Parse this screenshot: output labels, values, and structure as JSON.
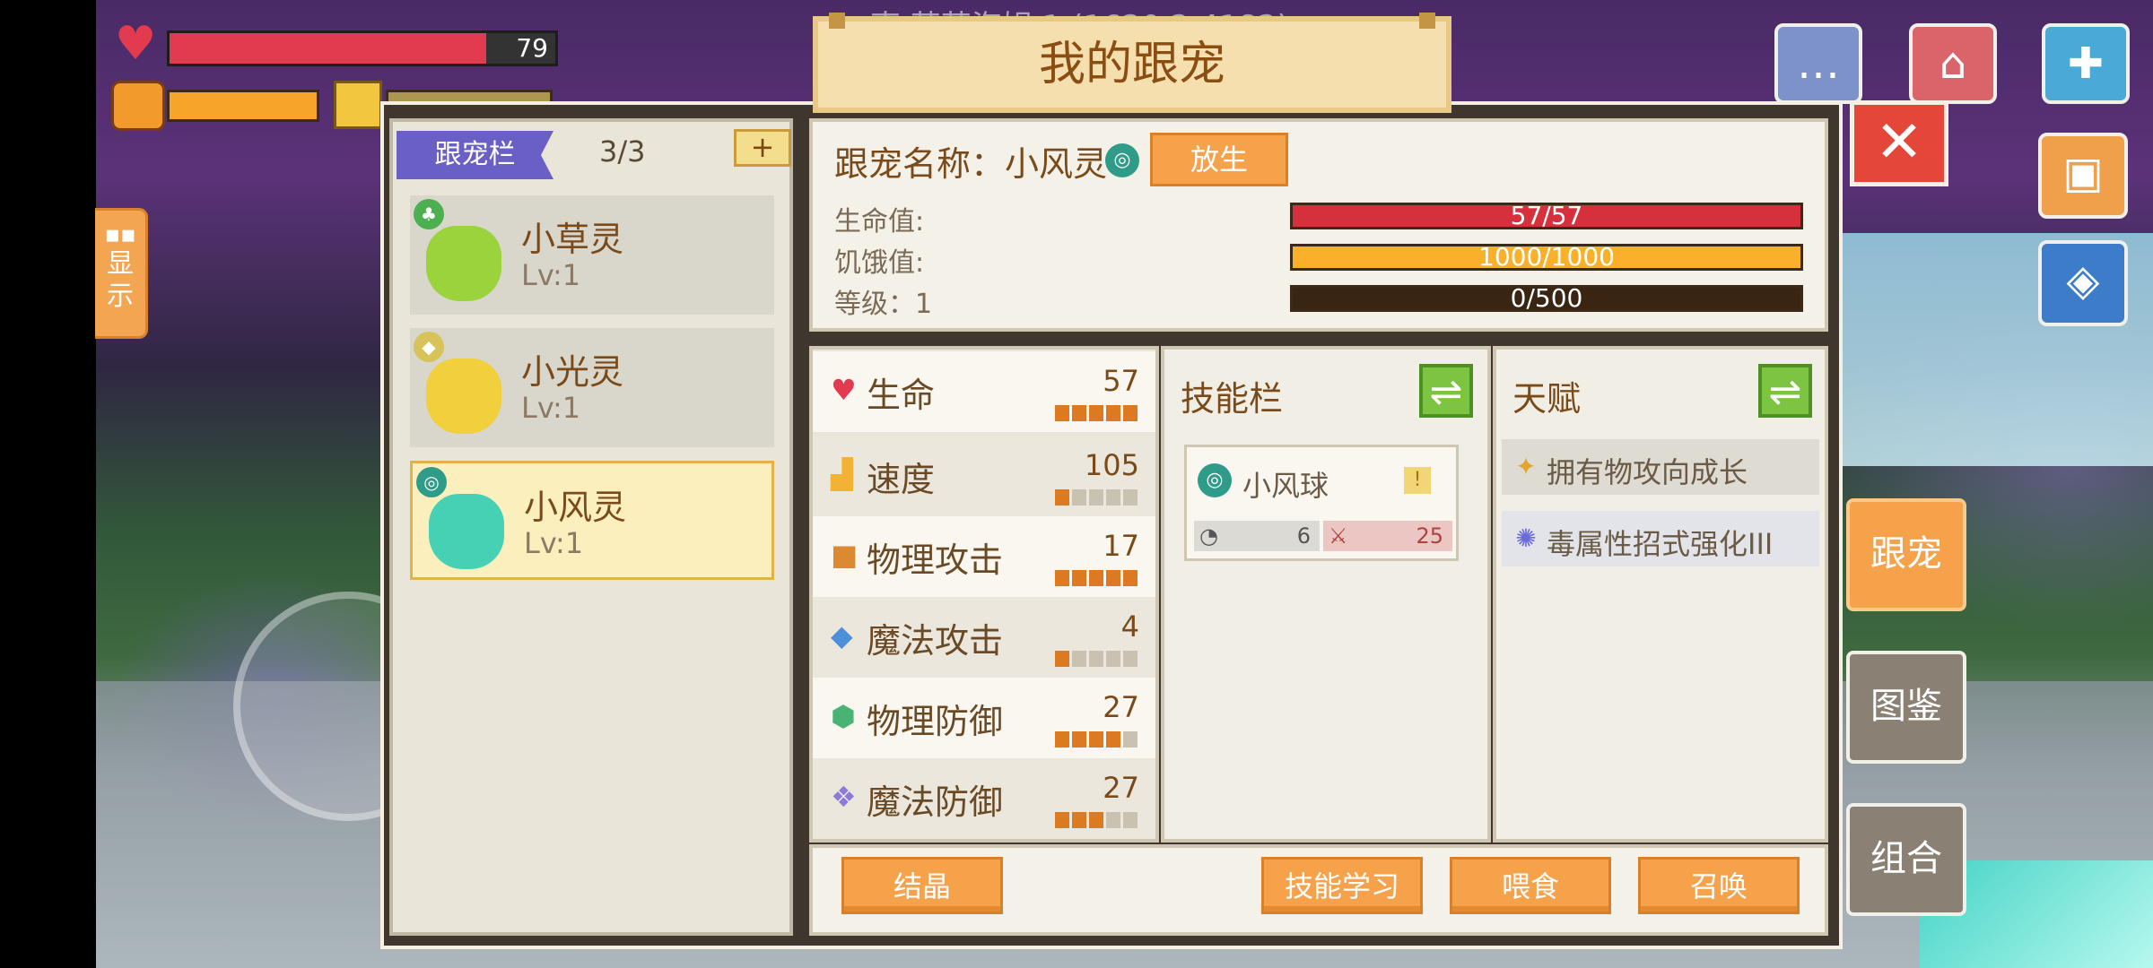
{
  "hud": {
    "hp_value": "79",
    "hp_fraction": 0.82,
    "top_text": "枣 营营海姆 1 (1620 2 4182)"
  },
  "show_tab": {
    "label_line1": "显",
    "label_line2": "示"
  },
  "title": "我的跟宠",
  "pet_list": {
    "header": "跟宠栏",
    "count": "3/3",
    "add_label": "+",
    "pets": [
      {
        "name": "小草灵",
        "level": "Lv:1",
        "color": "#9ad33b",
        "element_color": "#4caf50"
      },
      {
        "name": "小光灵",
        "level": "Lv:1",
        "color": "#f2cf3c",
        "element_color": "#d8c25a"
      },
      {
        "name": "小风灵",
        "level": "Lv:1",
        "color": "#47d1b4",
        "element_color": "#2f9b89"
      }
    ]
  },
  "info": {
    "name_label": "跟宠名称：小风灵",
    "release_label": "放生",
    "hp_label": "生命值:",
    "hunger_label": "饥饿值:",
    "level_label": "等级：1",
    "hp_bar": "57/57",
    "hunger_bar": "1000/1000",
    "exp_bar": "0/500"
  },
  "stats": [
    {
      "name": "生命",
      "value": "57",
      "pips_on": 5
    },
    {
      "name": "速度",
      "value": "105",
      "pips_on": 1
    },
    {
      "name": "物理攻击",
      "value": "17",
      "pips_on": 5
    },
    {
      "name": "魔法攻击",
      "value": "4",
      "pips_on": 1
    },
    {
      "name": "物理防御",
      "value": "27",
      "pips_on": 4
    },
    {
      "name": "魔法防御",
      "value": "27",
      "pips_on": 3
    }
  ],
  "skills": {
    "title": "技能栏",
    "card": {
      "name": "小风球",
      "cooldown": "6",
      "power": "25"
    }
  },
  "talent": {
    "title": "天赋",
    "items": [
      "拥有物攻向成长",
      "毒属性招式强化III"
    ]
  },
  "bottom": {
    "crystal": "结晶",
    "learn": "技能学习",
    "feed": "喂食",
    "summon": "召唤"
  },
  "side_tabs": [
    "跟宠",
    "图鉴",
    "组合"
  ],
  "colors": {
    "accent": "#f5a24b",
    "hp": "#d6303c",
    "hunger": "#fbb02c",
    "exp": "#3a2412"
  }
}
